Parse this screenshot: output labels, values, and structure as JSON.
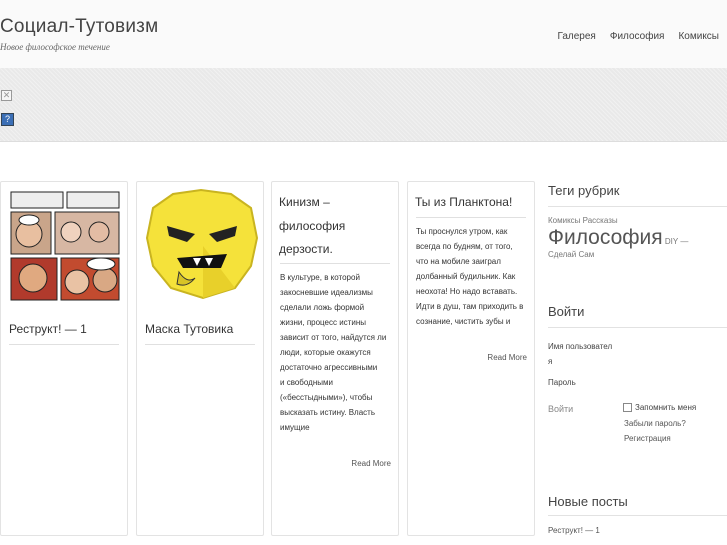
{
  "header": {
    "site_title": "Социал-Тутовизм",
    "site_description": "Новое философское течение",
    "nav": [
      "Галерея",
      "Философия",
      "Комиксы"
    ]
  },
  "posts": [
    {
      "title": "Реструкт! — 1"
    },
    {
      "title": "Маска Тутовика"
    },
    {
      "title_lines": [
        "Кинизм –",
        "философия",
        "дерзости."
      ],
      "excerpt_lines": [
        "В культуре, в которой",
        "закосневшие идеализмы",
        "сделали ложь формой",
        "жизни, процесс истины",
        "зависит от того, найдутся ли",
        "люди, которые окажутся",
        "достаточно агрессивными",
        "и свободными",
        "(«бесстыдными»), чтобы",
        "высказать истину. Власть",
        "имущие"
      ],
      "read_more": "Read More"
    },
    {
      "title": "Ты из Планктона!",
      "excerpt_lines": [
        "Ты проснулся утром, как",
        "всегда по будням, от того,",
        "что на мобиле заиграл",
        "долбанный будильник. Как",
        "неохота! Но надо вставать.",
        "Идти в душ, там приходить в",
        "сознание, чистить зубы и"
      ],
      "read_more": "Read More"
    }
  ],
  "sidebar": {
    "tags_heading": "Теги рубрик",
    "tags_line1": "Комиксы Рассказы",
    "tag_big": "Философия",
    "tag_after": "DIY —",
    "tags_line3": "Сделай Сам",
    "login_heading": "Войти",
    "username_label_1": "Имя пользовател",
    "username_label_2": "я",
    "password_label": "Пароль",
    "login_button": "Войти",
    "remember_me": "Запомнить меня",
    "forgot_password": "Забыли пароль?",
    "register": "Регистрация",
    "recent_heading": "Новые посты",
    "recent_posts": [
      "Реструкт! — 1"
    ]
  },
  "colors": {
    "header_bg": "#fafafa",
    "banner_bg": "#e9e9e9",
    "mask_yellow": "#f5e23a"
  }
}
